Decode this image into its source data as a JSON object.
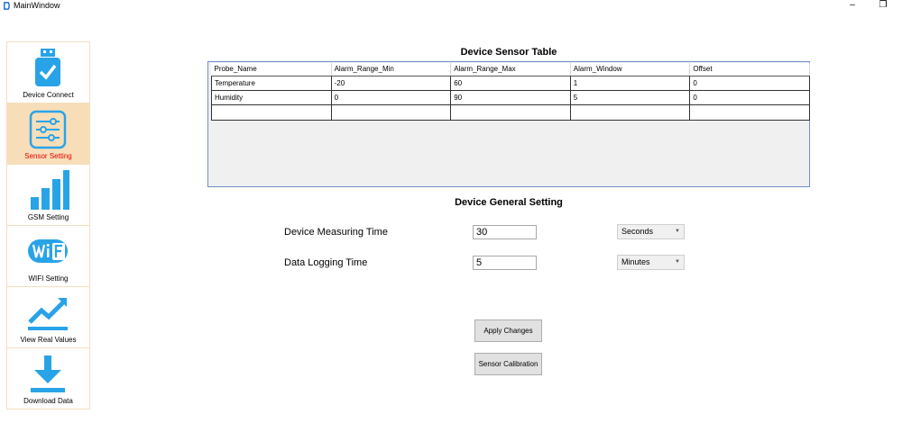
{
  "window": {
    "title": "MainWindow",
    "minimize_glyph": "–",
    "maximize_glyph": "❐"
  },
  "sidebar": {
    "active_index": 1,
    "items": [
      {
        "label": "Device Connect",
        "icon": "usb-check-icon"
      },
      {
        "label": "Sensor Setting",
        "icon": "sliders-icon"
      },
      {
        "label": "GSM Setting",
        "icon": "signal-bars-icon"
      },
      {
        "label": "WIFI Setting",
        "icon": "wifi-icon"
      },
      {
        "label": "View Real Values",
        "icon": "trend-line-icon"
      },
      {
        "label": "Download Data",
        "icon": "download-icon"
      }
    ]
  },
  "sensor_table": {
    "title": "Device Sensor Table",
    "columns": [
      "Probe_Name",
      "Alarm_Range_Min",
      "Alarm_Range_Max",
      "Alarm_Window",
      "Offset"
    ],
    "rows": [
      [
        "Temperature",
        "-20",
        "60",
        "1",
        "0"
      ],
      [
        "Humidity",
        "0",
        "90",
        "5",
        "0"
      ],
      [
        "",
        "",
        "",
        "",
        ""
      ]
    ]
  },
  "general": {
    "title": "Device General Setting",
    "measuring": {
      "label": "Device Measuring Time",
      "value": "30",
      "unit": "Seconds"
    },
    "logging": {
      "label": "Data Logging Time",
      "value": "5",
      "unit": "Minutes"
    }
  },
  "buttons": {
    "apply": "Apply Changes",
    "calibration": "Sensor Calibration"
  },
  "colors": {
    "accent": "#29a3e8",
    "active_bg": "#f7deb8",
    "active_text": "#e60000",
    "panel_border": "#f4dfc0"
  }
}
